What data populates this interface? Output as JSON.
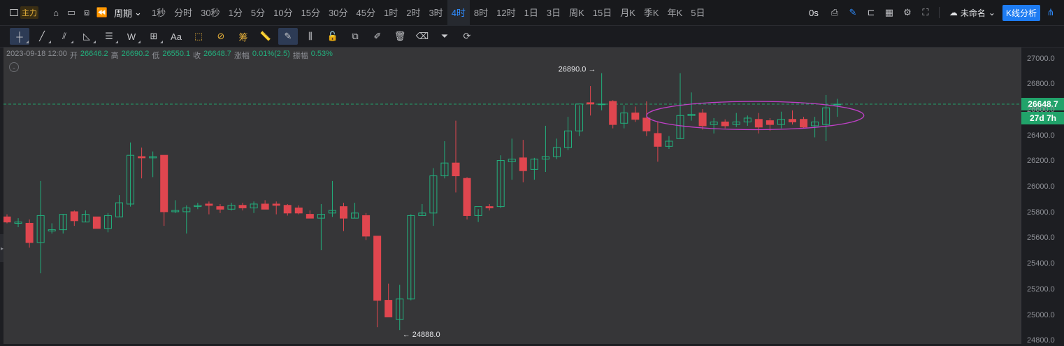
{
  "topbar": {
    "indicator_label": "主力",
    "period_label": "周期",
    "intervals": [
      "1秒",
      "分时",
      "30秒",
      "1分",
      "5分",
      "10分",
      "15分",
      "30分",
      "45分",
      "1时",
      "2时",
      "3时",
      "4时",
      "8时",
      "12时",
      "1日",
      "3日",
      "周K",
      "15日",
      "月K",
      "季K",
      "年K",
      "5日"
    ],
    "active_interval": "4时",
    "seconds_label": "0s",
    "layout_name": "未命名",
    "analysis_button": "K线分析"
  },
  "toolbar": {
    "tools": [
      {
        "name": "crosshair-tool",
        "glyph": "┼",
        "active": true,
        "corner": true
      },
      {
        "name": "trend-line-tool",
        "glyph": "╱",
        "active": false,
        "corner": true
      },
      {
        "name": "parallel-channel-tool",
        "glyph": "⫽",
        "active": false,
        "corner": true
      },
      {
        "name": "angle-tool",
        "glyph": "◺",
        "active": false,
        "corner": true
      },
      {
        "name": "horizontal-lines-tool",
        "glyph": "☰",
        "active": false,
        "corner": true
      },
      {
        "name": "wave-tool",
        "glyph": "W",
        "active": false,
        "corner": true
      },
      {
        "name": "rectangle-tool",
        "glyph": "⊞",
        "active": false,
        "corner": true
      },
      {
        "name": "text-tool",
        "glyph": "Aa",
        "active": false,
        "corner": false
      },
      {
        "name": "measure-tool",
        "glyph": "⬚",
        "active": false,
        "corner": false
      },
      {
        "name": "ban-tool",
        "glyph": "⊘",
        "active": false,
        "corner": false
      },
      {
        "name": "chips-tool",
        "glyph": "筹",
        "active": false,
        "corner": false
      },
      {
        "name": "ruler-tool",
        "glyph": "📏",
        "active": false,
        "corner": false
      },
      {
        "name": "magnet-tool",
        "glyph": "✎",
        "active": true,
        "corner": false
      },
      {
        "name": "candle-style-tool",
        "glyph": "⫼",
        "active": false,
        "corner": false
      },
      {
        "name": "lock-tool",
        "glyph": "🔓",
        "active": false,
        "corner": false
      },
      {
        "name": "copy-tool",
        "glyph": "⧉",
        "active": false,
        "corner": false
      },
      {
        "name": "edit-tool",
        "glyph": "✐",
        "active": false,
        "corner": false
      },
      {
        "name": "trash-tool",
        "glyph": "🗑",
        "active": false,
        "corner": false
      },
      {
        "name": "eraser-tool",
        "glyph": "⌫",
        "active": false,
        "corner": false
      },
      {
        "name": "filter-tool",
        "glyph": "⏷",
        "active": false,
        "corner": false
      },
      {
        "name": "sync-tool",
        "glyph": "⟳",
        "active": false,
        "corner": false
      }
    ]
  },
  "legend": {
    "datetime": "2023-09-18 12:00",
    "open_label": "开",
    "open": "26646.2",
    "high_label": "高",
    "high": "26690.2",
    "low_label": "低",
    "low": "26550.1",
    "close_label": "收",
    "close": "26648.7",
    "change_label": "涨幅",
    "change": "0.01%(2.5)",
    "amplitude_label": "振幅",
    "amplitude": "0.53%"
  },
  "price_axis": {
    "ticks": [
      "27000.0",
      "26800.0",
      "26600.0",
      "26400.0",
      "26200.0",
      "26000.0",
      "25800.0",
      "25600.0",
      "25400.0",
      "25200.0",
      "25000.0",
      "24800.0"
    ],
    "current_price": "26648.7",
    "countdown": "27d 7h"
  },
  "annotations": {
    "high_marker": "26890.0 →",
    "low_marker": "← 24888.0"
  },
  "colors": {
    "up": "#22b07d",
    "down": "#e0464f",
    "ellipse": "#c040c8",
    "current_line": "#21a36a",
    "accent": "#1e7cf2"
  },
  "chart_data": {
    "type": "candlestick",
    "y_unit": "price",
    "ylim": [
      24780,
      27090
    ],
    "candles": [
      {
        "o": 25770,
        "h": 25790,
        "l": 25720,
        "c": 25730
      },
      {
        "o": 25720,
        "h": 25760,
        "l": 25690,
        "c": 25730
      },
      {
        "o": 25720,
        "h": 25750,
        "l": 25530,
        "c": 25570
      },
      {
        "o": 25570,
        "h": 26050,
        "l": 25330,
        "c": 25780
      },
      {
        "o": 25660,
        "h": 25720,
        "l": 25640,
        "c": 25670
      },
      {
        "o": 25670,
        "h": 25790,
        "l": 25640,
        "c": 25790
      },
      {
        "o": 25810,
        "h": 25820,
        "l": 25700,
        "c": 25740
      },
      {
        "o": 25730,
        "h": 25820,
        "l": 25730,
        "c": 25790
      },
      {
        "o": 25770,
        "h": 25770,
        "l": 25680,
        "c": 25680
      },
      {
        "o": 25680,
        "h": 25800,
        "l": 25650,
        "c": 25780
      },
      {
        "o": 25770,
        "h": 25940,
        "l": 25770,
        "c": 25880
      },
      {
        "o": 25870,
        "h": 26350,
        "l": 25850,
        "c": 26250
      },
      {
        "o": 26240,
        "h": 26310,
        "l": 26070,
        "c": 26230
      },
      {
        "o": 26230,
        "h": 26280,
        "l": 26080,
        "c": 26240
      },
      {
        "o": 26250,
        "h": 26250,
        "l": 25700,
        "c": 25810
      },
      {
        "o": 25810,
        "h": 25900,
        "l": 25800,
        "c": 25820
      },
      {
        "o": 25810,
        "h": 25860,
        "l": 25640,
        "c": 25840
      },
      {
        "o": 25850,
        "h": 25880,
        "l": 25830,
        "c": 25860
      },
      {
        "o": 25870,
        "h": 25890,
        "l": 25790,
        "c": 25860
      },
      {
        "o": 25850,
        "h": 25870,
        "l": 25800,
        "c": 25830
      },
      {
        "o": 25830,
        "h": 25880,
        "l": 25820,
        "c": 25860
      },
      {
        "o": 25860,
        "h": 25880,
        "l": 25820,
        "c": 25840
      },
      {
        "o": 25840,
        "h": 25890,
        "l": 25800,
        "c": 25870
      },
      {
        "o": 25870,
        "h": 25900,
        "l": 25830,
        "c": 25830
      },
      {
        "o": 25870,
        "h": 25890,
        "l": 25790,
        "c": 25860
      },
      {
        "o": 25860,
        "h": 25870,
        "l": 25780,
        "c": 25800
      },
      {
        "o": 25840,
        "h": 25860,
        "l": 25790,
        "c": 25800
      },
      {
        "o": 25790,
        "h": 25820,
        "l": 25770,
        "c": 25760
      },
      {
        "o": 25760,
        "h": 25870,
        "l": 25510,
        "c": 25790
      },
      {
        "o": 25800,
        "h": 26050,
        "l": 25770,
        "c": 25820
      },
      {
        "o": 25850,
        "h": 25880,
        "l": 25660,
        "c": 25760
      },
      {
        "o": 25760,
        "h": 25880,
        "l": 25760,
        "c": 25800
      },
      {
        "o": 25780,
        "h": 25800,
        "l": 25590,
        "c": 25620
      },
      {
        "o": 25620,
        "h": 25620,
        "l": 24910,
        "c": 25120
      },
      {
        "o": 25120,
        "h": 25250,
        "l": 25070,
        "c": 24990
      },
      {
        "o": 24970,
        "h": 25240,
        "l": 24888,
        "c": 25130
      },
      {
        "o": 25130,
        "h": 25790,
        "l": 25120,
        "c": 25780
      },
      {
        "o": 25780,
        "h": 25870,
        "l": 25780,
        "c": 25800
      },
      {
        "o": 25800,
        "h": 26150,
        "l": 25700,
        "c": 26090
      },
      {
        "o": 26090,
        "h": 26360,
        "l": 26070,
        "c": 26190
      },
      {
        "o": 26190,
        "h": 26520,
        "l": 25960,
        "c": 26090
      },
      {
        "o": 26070,
        "h": 26080,
        "l": 25750,
        "c": 25780
      },
      {
        "o": 25780,
        "h": 25830,
        "l": 25730,
        "c": 25850
      },
      {
        "o": 25850,
        "h": 25870,
        "l": 25820,
        "c": 25840
      },
      {
        "o": 25850,
        "h": 26250,
        "l": 25840,
        "c": 26210
      },
      {
        "o": 26200,
        "h": 26380,
        "l": 26060,
        "c": 26220
      },
      {
        "o": 26230,
        "h": 26370,
        "l": 26040,
        "c": 26130
      },
      {
        "o": 26140,
        "h": 26230,
        "l": 26060,
        "c": 26220
      },
      {
        "o": 26220,
        "h": 26480,
        "l": 26120,
        "c": 26240
      },
      {
        "o": 26240,
        "h": 26380,
        "l": 26220,
        "c": 26310
      },
      {
        "o": 26310,
        "h": 26550,
        "l": 26290,
        "c": 26440
      },
      {
        "o": 26440,
        "h": 26640,
        "l": 26400,
        "c": 26650
      },
      {
        "o": 26660,
        "h": 26790,
        "l": 26560,
        "c": 26650
      },
      {
        "o": 26650,
        "h": 26890,
        "l": 26600,
        "c": 26650
      },
      {
        "o": 26670,
        "h": 26680,
        "l": 26460,
        "c": 26490
      },
      {
        "o": 26500,
        "h": 26640,
        "l": 26460,
        "c": 26580
      },
      {
        "o": 26580,
        "h": 26630,
        "l": 26510,
        "c": 26530
      },
      {
        "o": 26540,
        "h": 26670,
        "l": 26400,
        "c": 26440
      },
      {
        "o": 26420,
        "h": 26510,
        "l": 26200,
        "c": 26320
      },
      {
        "o": 26320,
        "h": 26400,
        "l": 26300,
        "c": 26360
      },
      {
        "o": 26380,
        "h": 26890,
        "l": 26380,
        "c": 26560
      },
      {
        "o": 26560,
        "h": 26740,
        "l": 26520,
        "c": 26570
      },
      {
        "o": 26580,
        "h": 26610,
        "l": 26450,
        "c": 26480
      },
      {
        "o": 26490,
        "h": 26540,
        "l": 26420,
        "c": 26510
      },
      {
        "o": 26510,
        "h": 26530,
        "l": 26460,
        "c": 26480
      },
      {
        "o": 26490,
        "h": 26580,
        "l": 26470,
        "c": 26510
      },
      {
        "o": 26510,
        "h": 26560,
        "l": 26480,
        "c": 26540
      },
      {
        "o": 26530,
        "h": 26580,
        "l": 26420,
        "c": 26470
      },
      {
        "o": 26520,
        "h": 26540,
        "l": 26440,
        "c": 26490
      },
      {
        "o": 26490,
        "h": 26590,
        "l": 26460,
        "c": 26530
      },
      {
        "o": 26530,
        "h": 26600,
        "l": 26490,
        "c": 26510
      },
      {
        "o": 26530,
        "h": 26550,
        "l": 26460,
        "c": 26470
      },
      {
        "o": 26480,
        "h": 26550,
        "l": 26390,
        "c": 26510
      },
      {
        "o": 26490,
        "h": 26720,
        "l": 26360,
        "c": 26620
      },
      {
        "o": 26646.2,
        "h": 26690.2,
        "l": 26550.1,
        "c": 26648.7
      }
    ],
    "ellipse": {
      "x_from_index": 59.5,
      "x_to_index": 74.5,
      "y_center": 26560,
      "y_half": 110
    }
  }
}
